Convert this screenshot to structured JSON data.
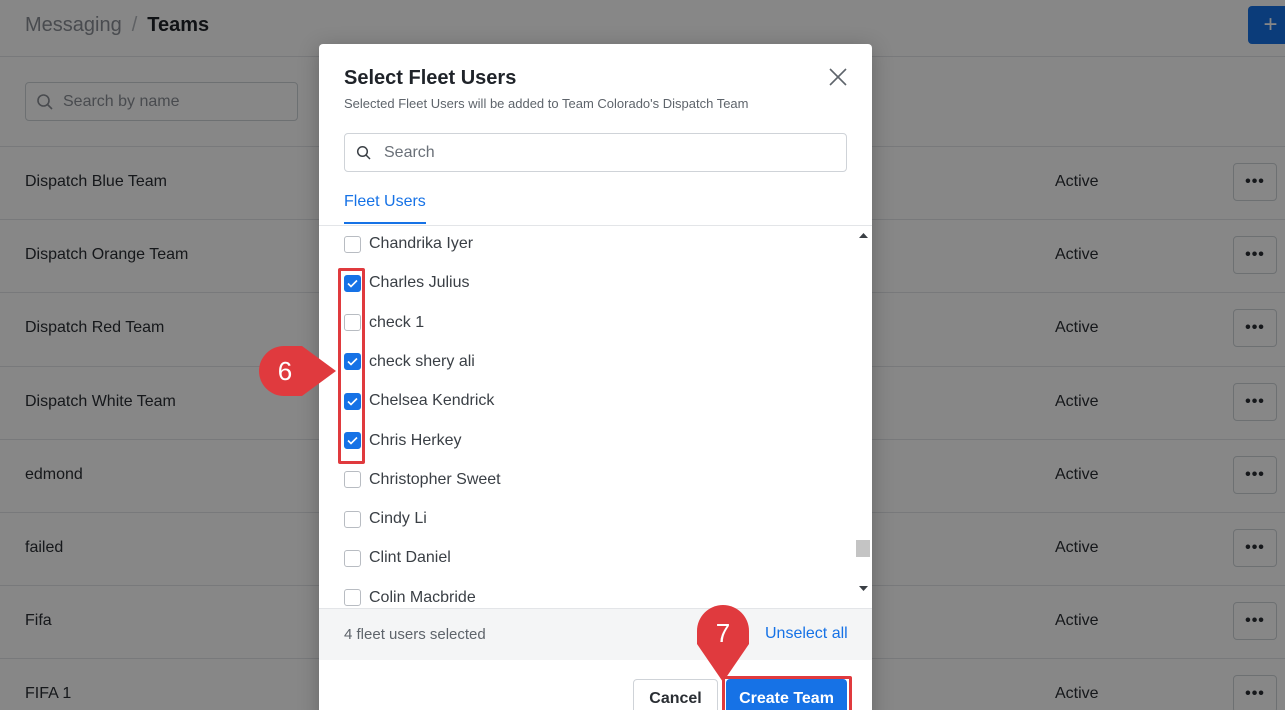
{
  "header": {
    "breadcrumb_parent": "Messaging",
    "breadcrumb_separator": "/",
    "breadcrumb_current": "Teams",
    "add_button_icon": "plus-icon"
  },
  "list_search": {
    "placeholder": "Search by name"
  },
  "teams": [
    {
      "name": "Dispatch Blue Team",
      "status": "Active",
      "menu": "•••"
    },
    {
      "name": "Dispatch Orange Team",
      "status": "Active",
      "menu": "•••"
    },
    {
      "name": "Dispatch Red Team",
      "status": "Active",
      "menu": "•••"
    },
    {
      "name": "Dispatch White Team",
      "status": "Active",
      "menu": "•••"
    },
    {
      "name": "edmond",
      "status": "Active",
      "menu": "•••"
    },
    {
      "name": "failed",
      "status": "Active",
      "menu": "•••"
    },
    {
      "name": "Fifa",
      "status": "Active",
      "menu": "•••"
    },
    {
      "name": "FIFA 1",
      "status": "Active",
      "menu": "•••"
    }
  ],
  "modal": {
    "title": "Select Fleet Users",
    "subtitle": "Selected Fleet Users will be added to Team Colorado's Dispatch Team",
    "search_placeholder": "Search",
    "tab_label": "Fleet Users",
    "users": [
      {
        "name": "Chandrika Iyer",
        "checked": false
      },
      {
        "name": "Charles Julius",
        "checked": true
      },
      {
        "name": "check 1",
        "checked": false
      },
      {
        "name": "check shery ali",
        "checked": true
      },
      {
        "name": "Chelsea Kendrick",
        "checked": true
      },
      {
        "name": "Chris Herkey",
        "checked": true
      },
      {
        "name": "Christopher Sweet",
        "checked": false
      },
      {
        "name": "Cindy Li",
        "checked": false
      },
      {
        "name": "Clint Daniel",
        "checked": false
      },
      {
        "name": "Colin Macbride",
        "checked": false
      }
    ],
    "selected_count_text": "4 fleet users selected",
    "unselect_all_label": "Unselect all",
    "cancel_label": "Cancel",
    "create_label": "Create Team"
  },
  "annotations": {
    "step_checkboxes": "6",
    "step_create": "7",
    "color": "#e03a3e"
  },
  "colors": {
    "accent": "#1672e6",
    "overlay": "rgba(0,0,0,0.47)",
    "annotation": "#e03a3e"
  }
}
